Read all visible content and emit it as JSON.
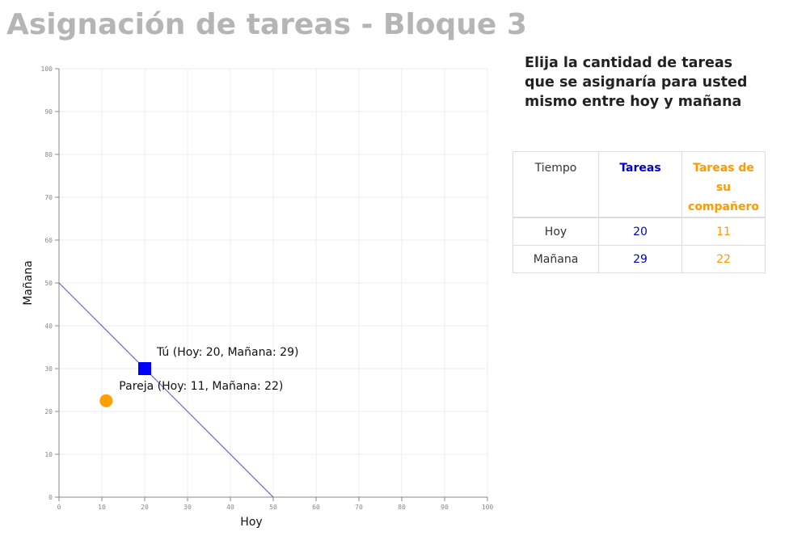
{
  "page": {
    "title": "Asignación de tareas - Bloque 3",
    "instructions": "Elija la cantidad de tareas que se asignaría para usted mismo entre hoy y mañana"
  },
  "table": {
    "headers": {
      "time": "Tiempo",
      "you": "Tareas",
      "partner": "Tareas de su compañero"
    },
    "rows": [
      {
        "time": "Hoy",
        "you": "20",
        "partner": "11"
      },
      {
        "time": "Mañana",
        "you": "29",
        "partner": "22"
      }
    ]
  },
  "colors": {
    "you": "#0000ff",
    "partner": "#ffa000",
    "budget_line": "#5555dd",
    "title": "#b5b5b5"
  },
  "chart_data": {
    "type": "scatter",
    "xlabel": "Hoy",
    "ylabel": "Mañana",
    "xlim": [
      0,
      100
    ],
    "ylim": [
      0,
      100
    ],
    "ticks": [
      0,
      10,
      20,
      30,
      40,
      50,
      60,
      70,
      80,
      90,
      100
    ],
    "grid": true,
    "budget_line": {
      "from": [
        0,
        50
      ],
      "to": [
        50,
        0
      ]
    },
    "points": [
      {
        "label": "Tú (Hoy: 20, Mañana: 29)",
        "x": 20,
        "y": 30,
        "marker": "square",
        "color": "#0000ff"
      },
      {
        "label": "Pareja (Hoy: 11, Mañana: 22)",
        "x": 11,
        "y": 22.5,
        "marker": "circle",
        "color": "#ffa000"
      }
    ]
  }
}
